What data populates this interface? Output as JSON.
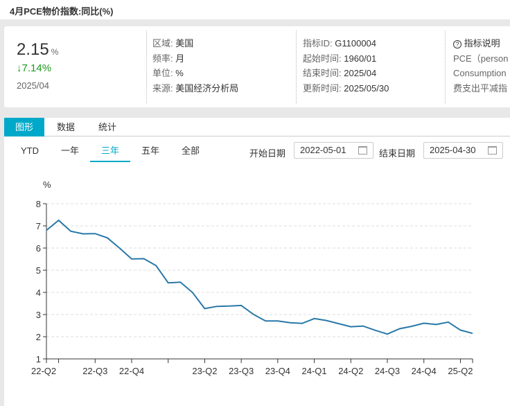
{
  "title": "4月PCE物价指数:同比(%)",
  "summary": {
    "value": "2.15",
    "unit": "%",
    "change": "↓7.14%",
    "date": "2025/04"
  },
  "meta1": [
    {
      "k": "区域:",
      "v": "美国"
    },
    {
      "k": "频率:",
      "v": "月"
    },
    {
      "k": "单位:",
      "v": "%"
    },
    {
      "k": "来源:",
      "v": "美国经济分析局"
    }
  ],
  "meta2": [
    {
      "k": "指标ID:",
      "v": "G1100004"
    },
    {
      "k": "起始时间:",
      "v": "1960/01"
    },
    {
      "k": "结束时间:",
      "v": "2025/04"
    },
    {
      "k": "更新时间:",
      "v": "2025/05/30"
    }
  ],
  "desc": {
    "icon": "help-circle-icon",
    "title": "指标说明",
    "lines": [
      "PCE（person",
      "Consumption",
      "费支出平减指"
    ]
  },
  "tabs": [
    "图形",
    "数据",
    "统计"
  ],
  "ranges": [
    "YTD",
    "一年",
    "三年",
    "五年",
    "全部"
  ],
  "start_label": "开始日期",
  "start_date": "2022-05-01",
  "end_label": "结束日期",
  "end_date": "2025-04-30",
  "colors": {
    "accent": "#00a9c9",
    "line": "#2878a8",
    "down": "#1a9a1a"
  },
  "chart_data": {
    "type": "line",
    "ylabel": "%",
    "ylim": [
      1,
      8
    ],
    "yticks": [
      1,
      2,
      3,
      4,
      5,
      6,
      7,
      8
    ],
    "grid": true,
    "values": [
      6.8,
      7.25,
      6.76,
      6.64,
      6.65,
      6.46,
      6.0,
      5.51,
      5.52,
      5.21,
      4.43,
      4.46,
      3.99,
      3.27,
      3.37,
      3.38,
      3.41,
      3.01,
      2.71,
      2.71,
      2.63,
      2.6,
      2.82,
      2.73,
      2.59,
      2.45,
      2.48,
      2.29,
      2.12,
      2.36,
      2.47,
      2.61,
      2.55,
      2.66,
      2.3,
      2.15
    ],
    "xticks": [
      {
        "i": 1,
        "label": "22-Q2"
      },
      {
        "i": 4,
        "label": "22-Q3"
      },
      {
        "i": 7,
        "label": "22-Q4"
      },
      {
        "i": 10,
        "label": ""
      },
      {
        "i": 13,
        "label": "23-Q2"
      },
      {
        "i": 16,
        "label": "23-Q3"
      },
      {
        "i": 19,
        "label": "23-Q4"
      },
      {
        "i": 22,
        "label": "24-Q1"
      },
      {
        "i": 25,
        "label": "24-Q2"
      },
      {
        "i": 28,
        "label": "24-Q3"
      },
      {
        "i": 31,
        "label": "24-Q4"
      },
      {
        "i": 34,
        "label": "25-Q2"
      }
    ]
  }
}
